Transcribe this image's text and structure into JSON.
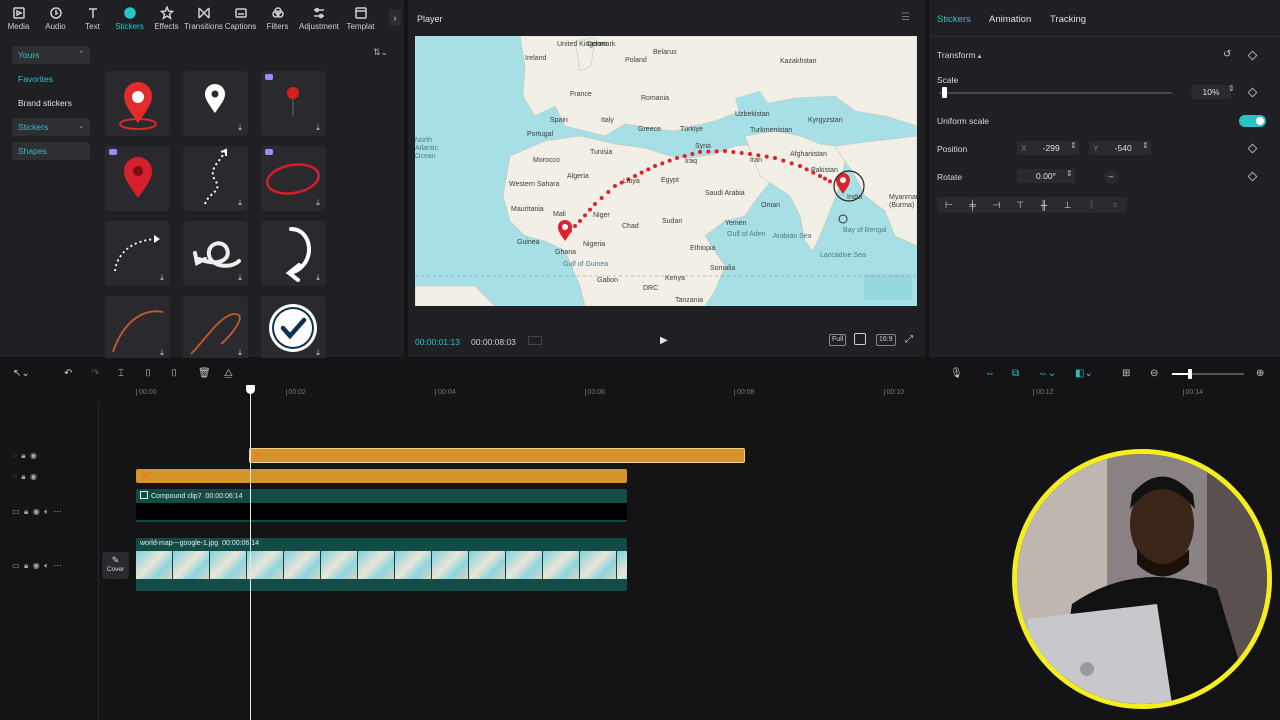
{
  "toolbar": {
    "tools": [
      {
        "label": "Media",
        "icon": "media-icon"
      },
      {
        "label": "Audio",
        "icon": "audio-icon"
      },
      {
        "label": "Text",
        "icon": "text-icon"
      },
      {
        "label": "Stickers",
        "icon": "stickers-icon",
        "active": true
      },
      {
        "label": "Effects",
        "icon": "effects-icon"
      },
      {
        "label": "Transitions",
        "icon": "transitions-icon"
      },
      {
        "label": "Captions",
        "icon": "captions-icon"
      },
      {
        "label": "Filters",
        "icon": "filters-icon"
      },
      {
        "label": "Adjustment",
        "icon": "adjustment-icon"
      },
      {
        "label": "Templat",
        "icon": "templates-icon"
      }
    ]
  },
  "stickers_sidebar": {
    "items": [
      {
        "label": "Yours",
        "state": "selected",
        "chevron": "⌃"
      },
      {
        "label": "Favorites",
        "state": "highlight"
      },
      {
        "label": "Brand stickers"
      },
      {
        "label": "Stickers",
        "state": "selected",
        "chevron": "⌄"
      },
      {
        "label": "Shapes",
        "state": "selected"
      }
    ]
  },
  "player": {
    "title": "Player",
    "current_time": "00:00:01:13",
    "total_time": "00:00:08:03",
    "controls": [
      "Full",
      "16:9"
    ],
    "map_labels": [
      {
        "t": "Denmark"
      },
      {
        "t": "United Kingdom"
      },
      {
        "t": "Belarus"
      },
      {
        "t": "Ireland"
      },
      {
        "t": "Poland"
      },
      {
        "t": "Kazakhstan"
      },
      {
        "t": "France"
      },
      {
        "t": "Romania"
      },
      {
        "t": "Spain"
      },
      {
        "t": "Portugal"
      },
      {
        "t": "Italy"
      },
      {
        "t": "Greece"
      },
      {
        "t": "Türkiye"
      },
      {
        "t": "Turkmenistan"
      },
      {
        "t": "Kyrgyzstan"
      },
      {
        "t": "Uzbekistan"
      },
      {
        "t": "North Atlantic Ocean"
      },
      {
        "t": "Tunisia"
      },
      {
        "t": "Syria"
      },
      {
        "t": "Iraq"
      },
      {
        "t": "Iran"
      },
      {
        "t": "Afghanistan"
      },
      {
        "t": "Morocco"
      },
      {
        "t": "Algeria"
      },
      {
        "t": "Libya"
      },
      {
        "t": "Egypt"
      },
      {
        "t": "Pakistan"
      },
      {
        "t": "Western Sahara"
      },
      {
        "t": "Saudi Arabia"
      },
      {
        "t": "Mauritania"
      },
      {
        "t": "Mali"
      },
      {
        "t": "Niger"
      },
      {
        "t": "Oman"
      },
      {
        "t": "India"
      },
      {
        "t": "Myanmar (Burma)"
      },
      {
        "t": "Chad"
      },
      {
        "t": "Sudan"
      },
      {
        "t": "Yemen"
      },
      {
        "t": "Guinea"
      },
      {
        "t": "Nigeria"
      },
      {
        "t": "Ethiopia"
      },
      {
        "t": "Ghana"
      },
      {
        "t": "Gulf of Aden"
      },
      {
        "t": "Arabian Sea"
      },
      {
        "t": "Bay of Bengal"
      },
      {
        "t": "Laccadive Sea"
      },
      {
        "t": "Somalia"
      },
      {
        "t": "Gulf of Guinea"
      },
      {
        "t": "Gabon"
      },
      {
        "t": "DRC"
      },
      {
        "t": "Kenya"
      },
      {
        "t": "Tanzania"
      }
    ]
  },
  "inspector": {
    "tabs": [
      "Stickers",
      "Animation",
      "Tracking"
    ],
    "transform_label": "Transform",
    "scale_label": "Scale",
    "scale_value": "10%",
    "scale_fraction": 0.1,
    "uniform_scale_label": "Uniform scale",
    "uniform_scale_on": true,
    "position_label": "Position",
    "x_label": "X",
    "x_value": "-299",
    "y_label": "Y",
    "y_value": "-540",
    "rotate_label": "Rotate",
    "rotate_value": "0.00°"
  },
  "timeline": {
    "ruler": [
      "00:00",
      "00:02",
      "00:04",
      "00:06",
      "00:08",
      "00:10",
      "00:12",
      "00:14"
    ],
    "compound_clip": {
      "name": "Compound clip7",
      "duration": "00:00:06:14"
    },
    "image_clip": {
      "name": "world-map---google-1.jpg",
      "duration": "00:00:06:14"
    },
    "cover_label": "Cover"
  },
  "colors": {
    "accent": "#29c3c6",
    "sticker_clip": "#d4932b",
    "compound_clip": "#114c47",
    "webcam_ring": "#f5ee1e",
    "route_dot": "#e0202a"
  }
}
